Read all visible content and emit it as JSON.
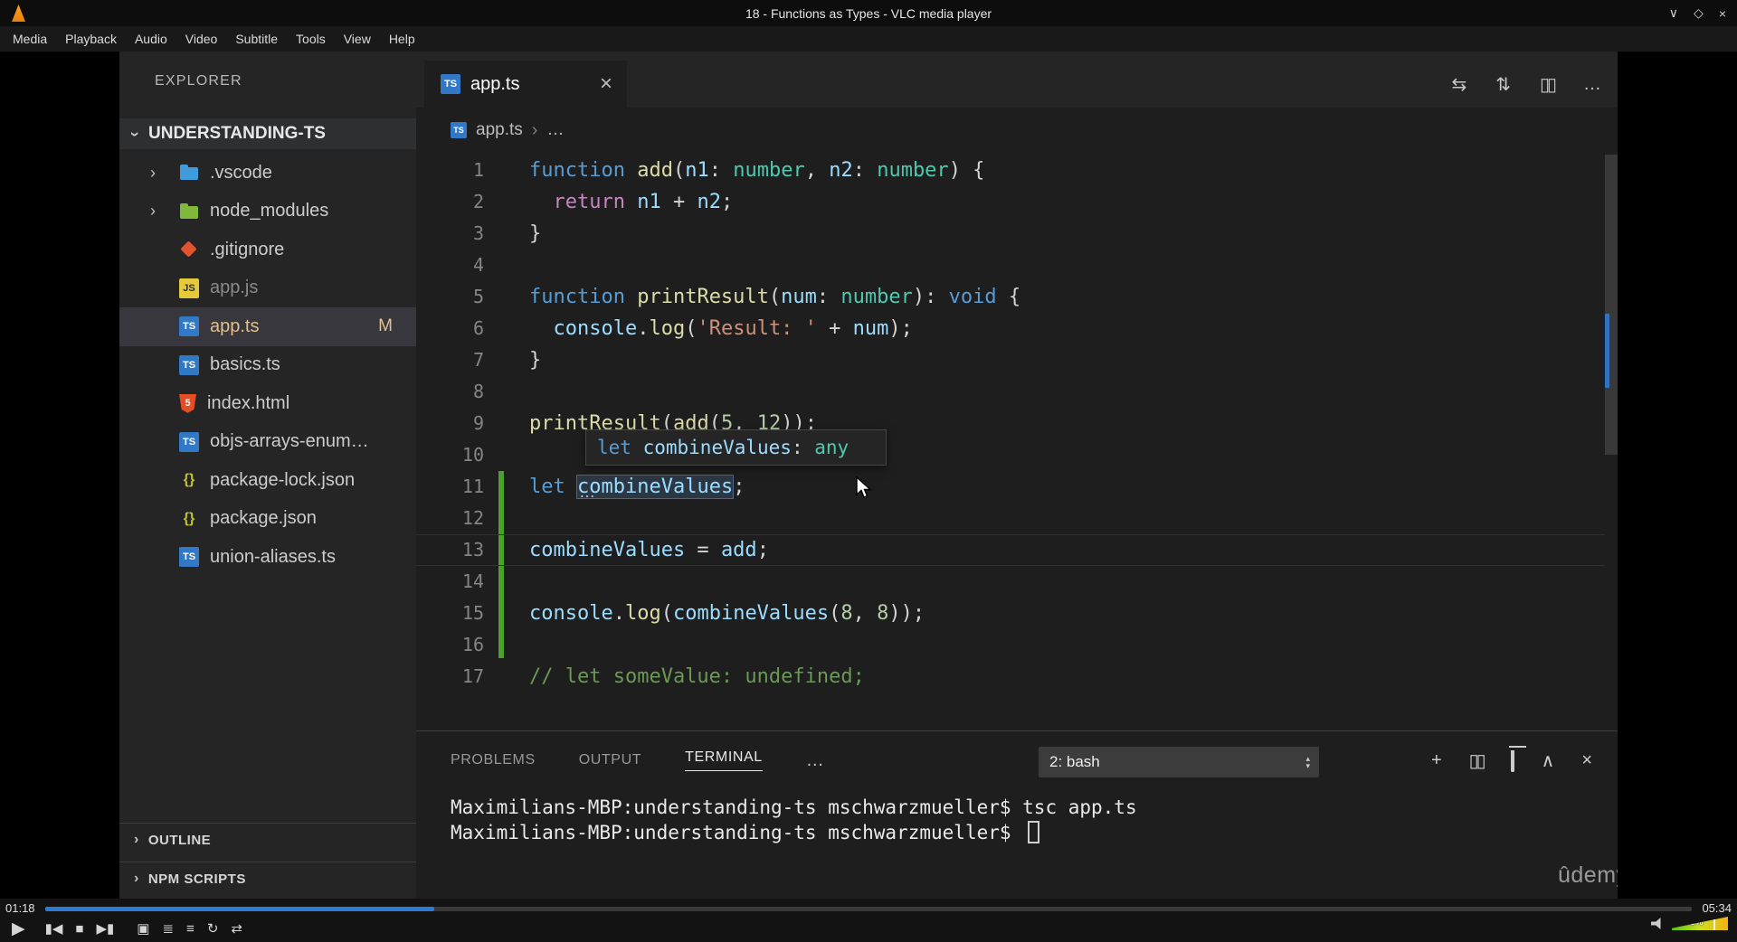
{
  "vlc": {
    "title": "18 - Functions as Types - VLC media player",
    "menu": [
      "Media",
      "Playback",
      "Audio",
      "Video",
      "Subtitle",
      "Tools",
      "View",
      "Help"
    ],
    "window_controls": [
      {
        "name": "minimize",
        "glyph": "∨"
      },
      {
        "name": "maximize",
        "glyph": "◇"
      },
      {
        "name": "close",
        "glyph": "×"
      }
    ],
    "time_elapsed": "01:18",
    "time_total": "05:34",
    "progress_percent": 23.6,
    "volume_label": "105%",
    "controls": [
      {
        "name": "play",
        "glyph": "▶"
      },
      {
        "name": "previous",
        "glyph": "▮◀"
      },
      {
        "name": "stop",
        "glyph": "■"
      },
      {
        "name": "next",
        "glyph": "▶▮"
      },
      {
        "name": "fullscreen",
        "glyph": "▣"
      },
      {
        "name": "extended-settings",
        "glyph": "≣"
      },
      {
        "name": "playlist",
        "glyph": "≡"
      },
      {
        "name": "loop",
        "glyph": "↻"
      },
      {
        "name": "random",
        "glyph": "⇄"
      }
    ]
  },
  "vscode": {
    "explorer": {
      "header": "EXPLORER",
      "root": "UNDERSTANDING-TS",
      "files": [
        {
          "name": ".vscode",
          "icon": "folder-vscode",
          "chevron": true
        },
        {
          "name": "node_modules",
          "icon": "folder-node",
          "chevron": true
        },
        {
          "name": ".gitignore",
          "icon": "git"
        },
        {
          "name": "app.js",
          "icon": "js",
          "dim": true
        },
        {
          "name": "app.ts",
          "icon": "ts",
          "selected": true,
          "modified": true,
          "badge": "M"
        },
        {
          "name": "basics.ts",
          "icon": "ts"
        },
        {
          "name": "index.html",
          "icon": "html"
        },
        {
          "name": "objs-arrays-enum…",
          "icon": "ts"
        },
        {
          "name": "package-lock.json",
          "icon": "json"
        },
        {
          "name": "package.json",
          "icon": "json"
        },
        {
          "name": "union-aliases.ts",
          "icon": "ts"
        }
      ],
      "sections": [
        "OUTLINE",
        "NPM SCRIPTS"
      ]
    },
    "editor": {
      "tab": "app.ts",
      "breadcrumb_file": "app.ts",
      "breadcrumb_more": "…",
      "actions": [
        {
          "name": "open-changes",
          "glyph": "⇆"
        },
        {
          "name": "git-compare",
          "glyph": "⇅"
        },
        {
          "name": "split-editor",
          "glyph": "▯▯"
        },
        {
          "name": "more-actions",
          "glyph": "…"
        }
      ],
      "code_lines": [
        {
          "n": 1,
          "seg": [
            [
              "function",
              "kw"
            ],
            [
              " ",
              "pl"
            ],
            [
              "add",
              "fn"
            ],
            [
              "(",
              "pl"
            ],
            [
              "n1",
              "vr"
            ],
            [
              ": ",
              "pl"
            ],
            [
              "number",
              "ty"
            ],
            [
              ", ",
              "pl"
            ],
            [
              "n2",
              "vr"
            ],
            [
              ": ",
              "pl"
            ],
            [
              "number",
              "ty"
            ],
            [
              ") {",
              "pl"
            ]
          ]
        },
        {
          "n": 2,
          "seg": [
            [
              "  ",
              "pl"
            ],
            [
              "return",
              "ct"
            ],
            [
              " ",
              "pl"
            ],
            [
              "n1",
              "vr"
            ],
            [
              " + ",
              "pl"
            ],
            [
              "n2",
              "vr"
            ],
            [
              ";",
              "pl"
            ]
          ]
        },
        {
          "n": 3,
          "seg": [
            [
              "}",
              "pl"
            ]
          ]
        },
        {
          "n": 4,
          "seg": []
        },
        {
          "n": 5,
          "seg": [
            [
              "function",
              "kw"
            ],
            [
              " ",
              "pl"
            ],
            [
              "printResult",
              "fn"
            ],
            [
              "(",
              "pl"
            ],
            [
              "num",
              "vr"
            ],
            [
              ": ",
              "pl"
            ],
            [
              "number",
              "ty"
            ],
            [
              "): ",
              "pl"
            ],
            [
              "void",
              "kw"
            ],
            [
              " {",
              "pl"
            ]
          ]
        },
        {
          "n": 6,
          "seg": [
            [
              "  ",
              "pl"
            ],
            [
              "console",
              "vr"
            ],
            [
              ".",
              "pl"
            ],
            [
              "log",
              "fn"
            ],
            [
              "(",
              "pl"
            ],
            [
              "'Result: '",
              "st"
            ],
            [
              " + ",
              "pl"
            ],
            [
              "num",
              "vr"
            ],
            [
              ");",
              "pl"
            ]
          ]
        },
        {
          "n": 7,
          "seg": [
            [
              "}",
              "pl"
            ]
          ]
        },
        {
          "n": 8,
          "seg": []
        },
        {
          "n": 9,
          "seg": [
            [
              "printResult",
              "fn"
            ],
            [
              "(",
              "pl"
            ],
            [
              "add",
              "fn"
            ],
            [
              "(",
              "pl"
            ],
            [
              "5",
              "nu"
            ],
            [
              ", ",
              "pl"
            ],
            [
              "12",
              "nu"
            ],
            [
              "));",
              "pl"
            ]
          ]
        },
        {
          "n": 10,
          "seg": []
        },
        {
          "n": 11,
          "seg": [
            [
              "let",
              "kw"
            ],
            [
              " ",
              "pl"
            ],
            [
              "combineValues",
              "vr hl"
            ],
            [
              ";",
              "pl"
            ]
          ]
        },
        {
          "n": 12,
          "seg": []
        },
        {
          "n": 13,
          "seg": [
            [
              "combineValues",
              "vr"
            ],
            [
              " = ",
              "pl"
            ],
            [
              "add",
              "vr"
            ],
            [
              ";",
              "pl"
            ]
          ],
          "current": true
        },
        {
          "n": 14,
          "seg": []
        },
        {
          "n": 15,
          "seg": [
            [
              "console",
              "vr"
            ],
            [
              ".",
              "pl"
            ],
            [
              "log",
              "fn"
            ],
            [
              "(",
              "pl"
            ],
            [
              "combineValues",
              "vr"
            ],
            [
              "(",
              "pl"
            ],
            [
              "8",
              "nu"
            ],
            [
              ", ",
              "pl"
            ],
            [
              "8",
              "nu"
            ],
            [
              "));",
              "pl"
            ]
          ]
        },
        {
          "n": 16,
          "seg": []
        },
        {
          "n": 17,
          "seg": [
            [
              "// let someValue: undefined;",
              "cm"
            ]
          ]
        }
      ],
      "tooltip": [
        [
          "let",
          "kw"
        ],
        [
          " ",
          "pl"
        ],
        [
          "combineValues",
          "vr"
        ],
        [
          ": ",
          "pl"
        ],
        [
          "any",
          "ty"
        ]
      ],
      "hover_dots": "…"
    },
    "panel": {
      "tabs": [
        "PROBLEMS",
        "OUTPUT",
        "TERMINAL"
      ],
      "active_tab": "TERMINAL",
      "more": "…",
      "shell_select": "2: bash",
      "icons": [
        {
          "name": "new-terminal",
          "glyph": "+"
        },
        {
          "name": "split-terminal",
          "glyph": "▯▯"
        },
        {
          "name": "kill-terminal",
          "glyph": "trash"
        },
        {
          "name": "maximize-panel",
          "glyph": "∧"
        },
        {
          "name": "close-panel",
          "glyph": "×"
        }
      ],
      "terminal_lines": [
        "Maximilians-MBP:understanding-ts mschwarzmueller$ tsc app.ts",
        "Maximilians-MBP:understanding-ts mschwarzmueller$ "
      ]
    },
    "watermark": "ûdemy",
    "icons": {
      "tab_close": "×",
      "tree_chevron": "›",
      "breadcrumb_chevron": "›",
      "dropdown_up": "▴",
      "dropdown_down": "▾"
    }
  }
}
